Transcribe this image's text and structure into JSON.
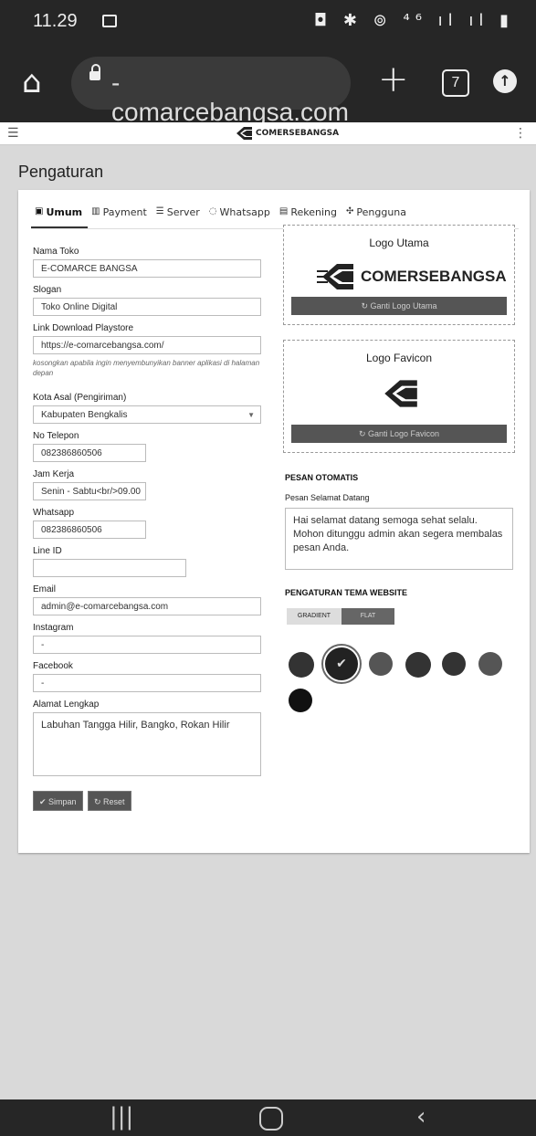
{
  "status": {
    "time": "11.29",
    "icons": "◘ ✱ ⊚ ⁴⁶ ıl ıl ▮"
  },
  "browser": {
    "domain": "-comarcebangsa.com",
    "tab_count": "7"
  },
  "site": {
    "brand": "COMERSEBANGSA"
  },
  "page_title": "Pengaturan",
  "tabs": [
    {
      "icon": "▣",
      "label": "Umum"
    },
    {
      "icon": "▥",
      "label": "Payment"
    },
    {
      "icon": "☰",
      "label": "Server"
    },
    {
      "icon": "◌",
      "label": "Whatsapp"
    },
    {
      "icon": "▤",
      "label": "Rekening"
    },
    {
      "icon": "✣",
      "label": "Pengguna"
    }
  ],
  "form": {
    "nama_toko_label": "Nama Toko",
    "nama_toko": "E-COMARCE BANGSA",
    "slogan_label": "Slogan",
    "slogan": "Toko Online Digital",
    "playstore_label": "Link Download Playstore",
    "playstore": "https://e-comarcebangsa.com/",
    "playstore_help": "kosongkan apabila ingin menyembunyikan banner aplikasi di halaman depan",
    "kota_label": "Kota Asal (Pengiriman)",
    "kota": "Kabupaten Bengkalis",
    "telepon_label": "No Telepon",
    "telepon": "082386860506",
    "jam_label": "Jam Kerja",
    "jam": "Senin - Sabtu<br/>09.00",
    "whatsapp_label": "Whatsapp",
    "whatsapp": "082386860506",
    "line_label": "Line ID",
    "line": "",
    "email_label": "Email",
    "email": "admin@e-comarcebangsa.com",
    "instagram_label": "Instagram",
    "instagram": "-",
    "facebook_label": "Facebook",
    "facebook": "-",
    "alamat_label": "Alamat Lengkap",
    "alamat": "Labuhan Tangga Hilir, Bangko, Rokan Hilir",
    "save": "✔ Simpan",
    "reset": "↻ Reset"
  },
  "logo_utama": {
    "title": "Logo Utama",
    "button": "↻ Ganti Logo Utama",
    "brand": "COMERSEBANGSA"
  },
  "logo_favicon": {
    "title": "Logo Favicon",
    "button": "↻ Ganti Logo Favicon"
  },
  "pesan": {
    "section": "PESAN OTOMATIS",
    "label": "Pesan Selamat Datang",
    "text": "Hai selamat datang semoga sehat selalu. Mohon ditunggu admin akan segera membalas pesan Anda."
  },
  "tema": {
    "section": "PENGATURAN TEMA WEBSITE",
    "gradient": "GRADIENT",
    "flat": "FLAT"
  },
  "colors": {
    "dot": "#333333",
    "dot_mid": "#555555",
    "page_bg": "#d9d9d9"
  }
}
